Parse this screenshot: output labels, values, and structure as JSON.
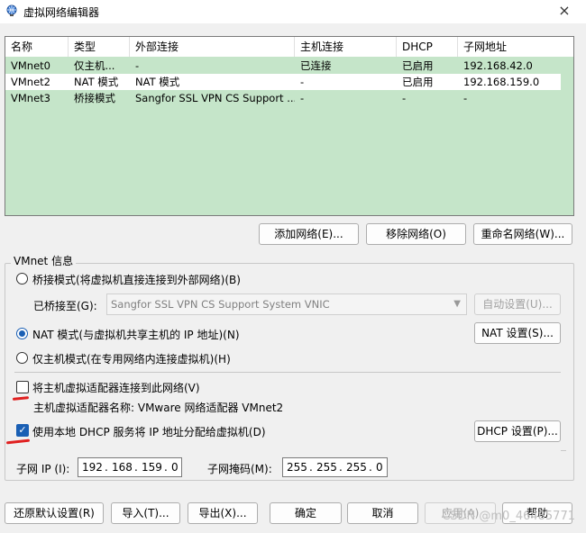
{
  "window": {
    "title": "虚拟网络编辑器",
    "close_icon": "×"
  },
  "table": {
    "headers": [
      "名称",
      "类型",
      "外部连接",
      "主机连接",
      "DHCP",
      "子网地址"
    ],
    "rows": [
      [
        "VMnet0",
        "仅主机...",
        "-",
        "已连接",
        "已启用",
        "192.168.42.0"
      ],
      [
        "VMnet2",
        "NAT 模式",
        "NAT 模式",
        "-",
        "已启用",
        "192.168.159.0"
      ],
      [
        "VMnet3",
        "桥接模式",
        "Sangfor SSL VPN CS Support ...",
        "-",
        "-",
        "-"
      ]
    ],
    "selected_row": 1
  },
  "table_buttons": {
    "add": "添加网络(E)...",
    "remove": "移除网络(O)",
    "rename": "重命名网络(W)..."
  },
  "vmnet_info": {
    "legend": "VMnet 信息",
    "bridged_label": "桥接模式(将虚拟机直接连接到外部网络)(B)",
    "bridged_to_label": "已桥接至(G):",
    "bridged_to_value": "Sangfor SSL VPN CS Support System VNIC",
    "auto_settings": "自动设置(U)...",
    "nat_label": "NAT 模式(与虚拟机共享主机的 IP 地址)(N)",
    "nat_settings": "NAT 设置(S)...",
    "hostonly_label": "仅主机模式(在专用网络内连接虚拟机)(H)",
    "connect_adapter_label": "将主机虚拟适配器连接到此网络(V)",
    "adapter_name_label": "主机虚拟适配器名称: VMware 网络适配器 VMnet2",
    "dhcp_label": "使用本地 DHCP 服务将 IP 地址分配给虚拟机(D)",
    "dhcp_settings": "DHCP 设置(P)...",
    "subnet_ip_label": "子网 IP (I):",
    "subnet_ip": [
      "192",
      "168",
      "159",
      "0"
    ],
    "subnet_mask_label": "子网掩码(M):",
    "subnet_mask": [
      "255",
      "255",
      "255",
      "0"
    ],
    "selected_mode": "nat",
    "connect_adapter_checked": false,
    "dhcp_checked": true
  },
  "bottom_buttons": {
    "restore": "还原默认设置(R)",
    "import": "导入(T)...",
    "export": "导出(X)...",
    "ok": "确定",
    "cancel": "取消",
    "apply": "应用(A)",
    "help": "帮助"
  },
  "watermark": "CSDN @m0_46485771",
  "colors": {
    "table_bg": "#c5e5c9",
    "accent": "#1a5fb4",
    "annotation_red": "#e02020"
  }
}
